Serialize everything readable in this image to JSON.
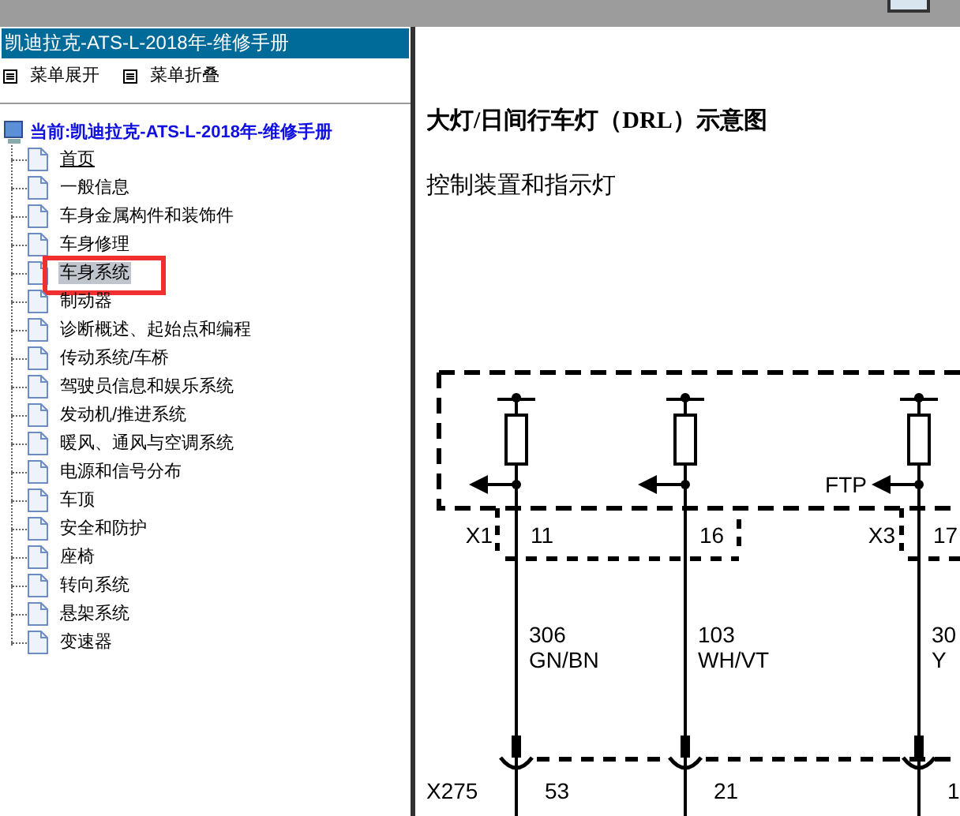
{
  "sidebar": {
    "title": "凯迪拉克-ATS-L-2018年-维修手册",
    "menu": [
      {
        "label": "菜单展开"
      },
      {
        "label": "菜单折叠"
      }
    ],
    "tree": {
      "label": "当前:凯迪拉克-ATS-L-2018年-维修手册",
      "children": [
        {
          "label": "首页",
          "selected": false,
          "hovered": true,
          "highlighted": false
        },
        {
          "label": "一般信息",
          "selected": false,
          "hovered": false,
          "highlighted": false
        },
        {
          "label": "车身金属构件和装饰件",
          "selected": false,
          "hovered": false,
          "highlighted": false
        },
        {
          "label": "车身修理",
          "selected": false,
          "hovered": false,
          "highlighted": false
        },
        {
          "label": "车身系统",
          "selected": true,
          "hovered": false,
          "highlighted": true
        },
        {
          "label": "制动器",
          "selected": false,
          "hovered": false,
          "highlighted": false
        },
        {
          "label": "诊断概述、起始点和编程",
          "selected": false,
          "hovered": false,
          "highlighted": false
        },
        {
          "label": "传动系统/车桥",
          "selected": false,
          "hovered": false,
          "highlighted": false
        },
        {
          "label": "驾驶员信息和娱乐系统",
          "selected": false,
          "hovered": false,
          "highlighted": false
        },
        {
          "label": "发动机/推进系统",
          "selected": false,
          "hovered": false,
          "highlighted": false
        },
        {
          "label": "暖风、通风与空调系统",
          "selected": false,
          "hovered": false,
          "highlighted": false
        },
        {
          "label": "电源和信号分布",
          "selected": false,
          "hovered": false,
          "highlighted": false
        },
        {
          "label": "车顶",
          "selected": false,
          "hovered": false,
          "highlighted": false
        },
        {
          "label": "安全和防护",
          "selected": false,
          "hovered": false,
          "highlighted": false
        },
        {
          "label": "座椅",
          "selected": false,
          "hovered": false,
          "highlighted": false
        },
        {
          "label": "转向系统",
          "selected": false,
          "hovered": false,
          "highlighted": false
        },
        {
          "label": "悬架系统",
          "selected": false,
          "hovered": false,
          "highlighted": false
        },
        {
          "label": "变速器",
          "selected": false,
          "hovered": false,
          "highlighted": false
        }
      ]
    }
  },
  "content": {
    "title": "大灯/日间行车灯（DRL）示意图",
    "subtitle": "控制装置和指示灯",
    "diagram": {
      "bottom_connector": "X275",
      "wires": [
        {
          "top_connector": "X1",
          "top_pin": "11",
          "circuit": "306",
          "wire_color": "GN/BN",
          "bottom_pin": "53"
        },
        {
          "top_pin": "16",
          "circuit": "103",
          "wire_color": "WH/VT",
          "bottom_pin": "21"
        },
        {
          "top_connector": "X3",
          "top_pin": "17",
          "signal": "FTP",
          "circuit": "30",
          "wire_color": "Y",
          "bottom_pin": "1"
        }
      ]
    }
  }
}
